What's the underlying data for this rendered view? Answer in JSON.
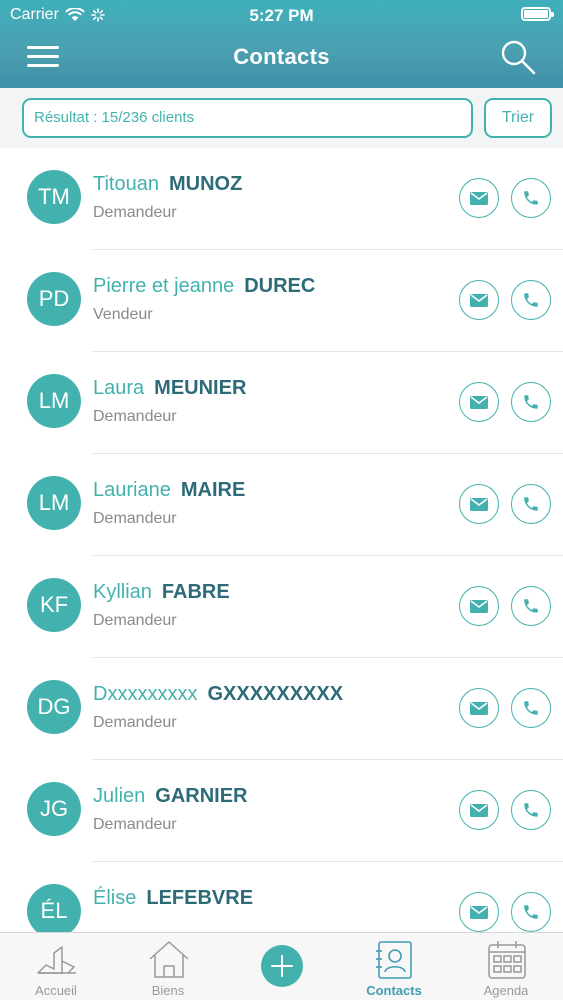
{
  "status_bar": {
    "carrier": "Carrier",
    "time": "5:27 PM"
  },
  "header": {
    "title": "Contacts",
    "menu_icon": "hamburger-menu-icon",
    "search_icon": "search-icon"
  },
  "toolbar": {
    "result_text": "Résultat : 15/236 clients",
    "sort_label": "Trier"
  },
  "contacts": [
    {
      "initials": "TM",
      "first_name": "Titouan",
      "last_name": "MUNOZ",
      "role": "Demandeur"
    },
    {
      "initials": "PD",
      "first_name": "Pierre et jeanne",
      "last_name": "DUREC",
      "role": "Vendeur"
    },
    {
      "initials": "LM",
      "first_name": "Laura",
      "last_name": "MEUNIER",
      "role": "Demandeur"
    },
    {
      "initials": "LM",
      "first_name": "Lauriane",
      "last_name": "MAIRE",
      "role": "Demandeur"
    },
    {
      "initials": "KF",
      "first_name": "Kyllian",
      "last_name": "FABRE",
      "role": "Demandeur"
    },
    {
      "initials": "DG",
      "first_name": "Dxxxxxxxxx",
      "last_name": "GXXXXXXXXX",
      "role": "Demandeur"
    },
    {
      "initials": "JG",
      "first_name": "Julien",
      "last_name": "GARNIER",
      "role": "Demandeur"
    },
    {
      "initials": "ÉL",
      "first_name": "Élise",
      "last_name": "LEFEBVRE",
      "role": ""
    }
  ],
  "tabbar": {
    "tabs": [
      {
        "label": "Accueil",
        "icon": "home-city-icon",
        "active": false
      },
      {
        "label": "Biens",
        "icon": "house-icon",
        "active": false
      },
      {
        "label": "",
        "icon": "plus-icon",
        "active": false
      },
      {
        "label": "Contacts",
        "icon": "contact-card-icon",
        "active": true
      },
      {
        "label": "Agenda",
        "icon": "calendar-icon",
        "active": false
      }
    ]
  },
  "colors": {
    "accent": "#43b2ae",
    "header": "#4a9fb0",
    "last_name": "#2e6b79",
    "role": "#8a8a8a"
  }
}
